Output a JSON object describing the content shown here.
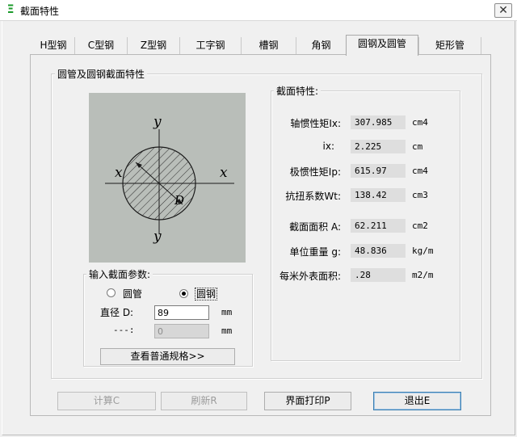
{
  "window": {
    "title": "截面特性",
    "close_glyph": "✕",
    "icon_glyph": "Ξ"
  },
  "tabs": [
    {
      "label": "H型钢",
      "active": false
    },
    {
      "label": "C型钢",
      "active": false
    },
    {
      "label": "Z型钢",
      "active": false
    },
    {
      "label": "工字钢",
      "active": false
    },
    {
      "label": "槽钢",
      "active": false
    },
    {
      "label": "角钢",
      "active": false
    },
    {
      "label": "圆钢及圆管",
      "active": true
    },
    {
      "label": "矩形管",
      "active": false
    }
  ],
  "section_group": {
    "title": "圆管及圆钢截面特性"
  },
  "diagram": {
    "label_y_top": "y",
    "label_y_bottom": "y",
    "label_x_left": "x",
    "label_x_right": "x",
    "label_d": "D",
    "background": "#b9beb9"
  },
  "input_group": {
    "title": "输入截面参数:",
    "radio_tube_label": "圆管",
    "radio_bar_label": "圆钢",
    "selected": "圆钢",
    "diameter_label": "直径 D:",
    "diameter_value": "89",
    "diameter_unit": "mm",
    "second_label": "---:",
    "second_value": "0",
    "second_unit": "mm",
    "spec_button": "查看普通规格>>"
  },
  "props_group": {
    "title": "截面特性:",
    "rows": [
      {
        "label": "轴惯性矩Ix:",
        "value": "307.985",
        "unit": "cm4"
      },
      {
        "label": "ix:",
        "value": "2.225",
        "unit": "cm"
      },
      {
        "label": "极惯性矩Ip:",
        "value": "615.97",
        "unit": "cm4"
      },
      {
        "label": "抗扭系数Wt:",
        "value": "138.42",
        "unit": "cm3"
      },
      {
        "label": "截面面积 A:",
        "value": "62.211",
        "unit": "cm2"
      },
      {
        "label": "单位重量 g:",
        "value": "48.836",
        "unit": "kg/m"
      },
      {
        "label": "每米外表面积:",
        "value": ".28",
        "unit": "m2/m"
      }
    ]
  },
  "buttons": {
    "calc": "计算C",
    "refresh": "刷新R",
    "print": "界面打印P",
    "exit": "退出E"
  }
}
